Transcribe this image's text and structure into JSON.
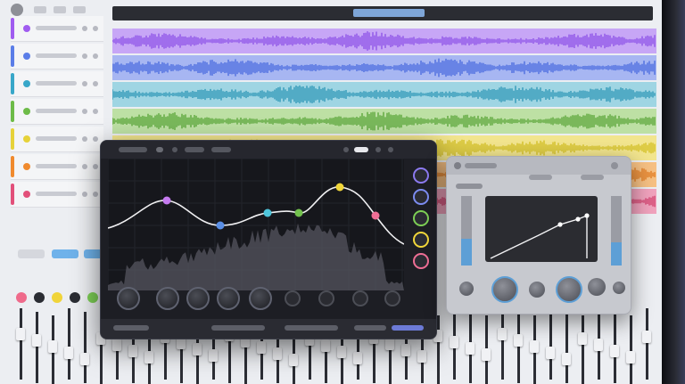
{
  "track_colors": [
    "#a05cf0",
    "#5a7de8",
    "#38a7c9",
    "#6dbb48",
    "#e6d23a",
    "#f08a2e",
    "#e2507a"
  ],
  "lane_colors": [
    "#c7a6f6",
    "#a7b6f2",
    "#9fd5e3",
    "#bde0a4",
    "#f2e58e",
    "#f6c083",
    "#f0a2bd"
  ],
  "wave_colors": [
    "#8b4fe8",
    "#4668de",
    "#2a95b5",
    "#56a334",
    "#d2be20",
    "#e2781d",
    "#d23f6c"
  ],
  "eq_node_colors": [
    "#c57bf0",
    "#5a8fe6",
    "#4fc6dc",
    "#72c24d",
    "#f1d63a",
    "#ee6e95"
  ],
  "mixer": {
    "send_colors": [
      "#ef6a8b",
      "#2a2c33",
      "#f0d43a",
      "#2a2c33",
      "#7dcf55"
    ]
  },
  "windows": {
    "eq": {
      "name": "eq-plugin-window"
    },
    "compressor": {
      "name": "compressor-plugin-window"
    }
  }
}
